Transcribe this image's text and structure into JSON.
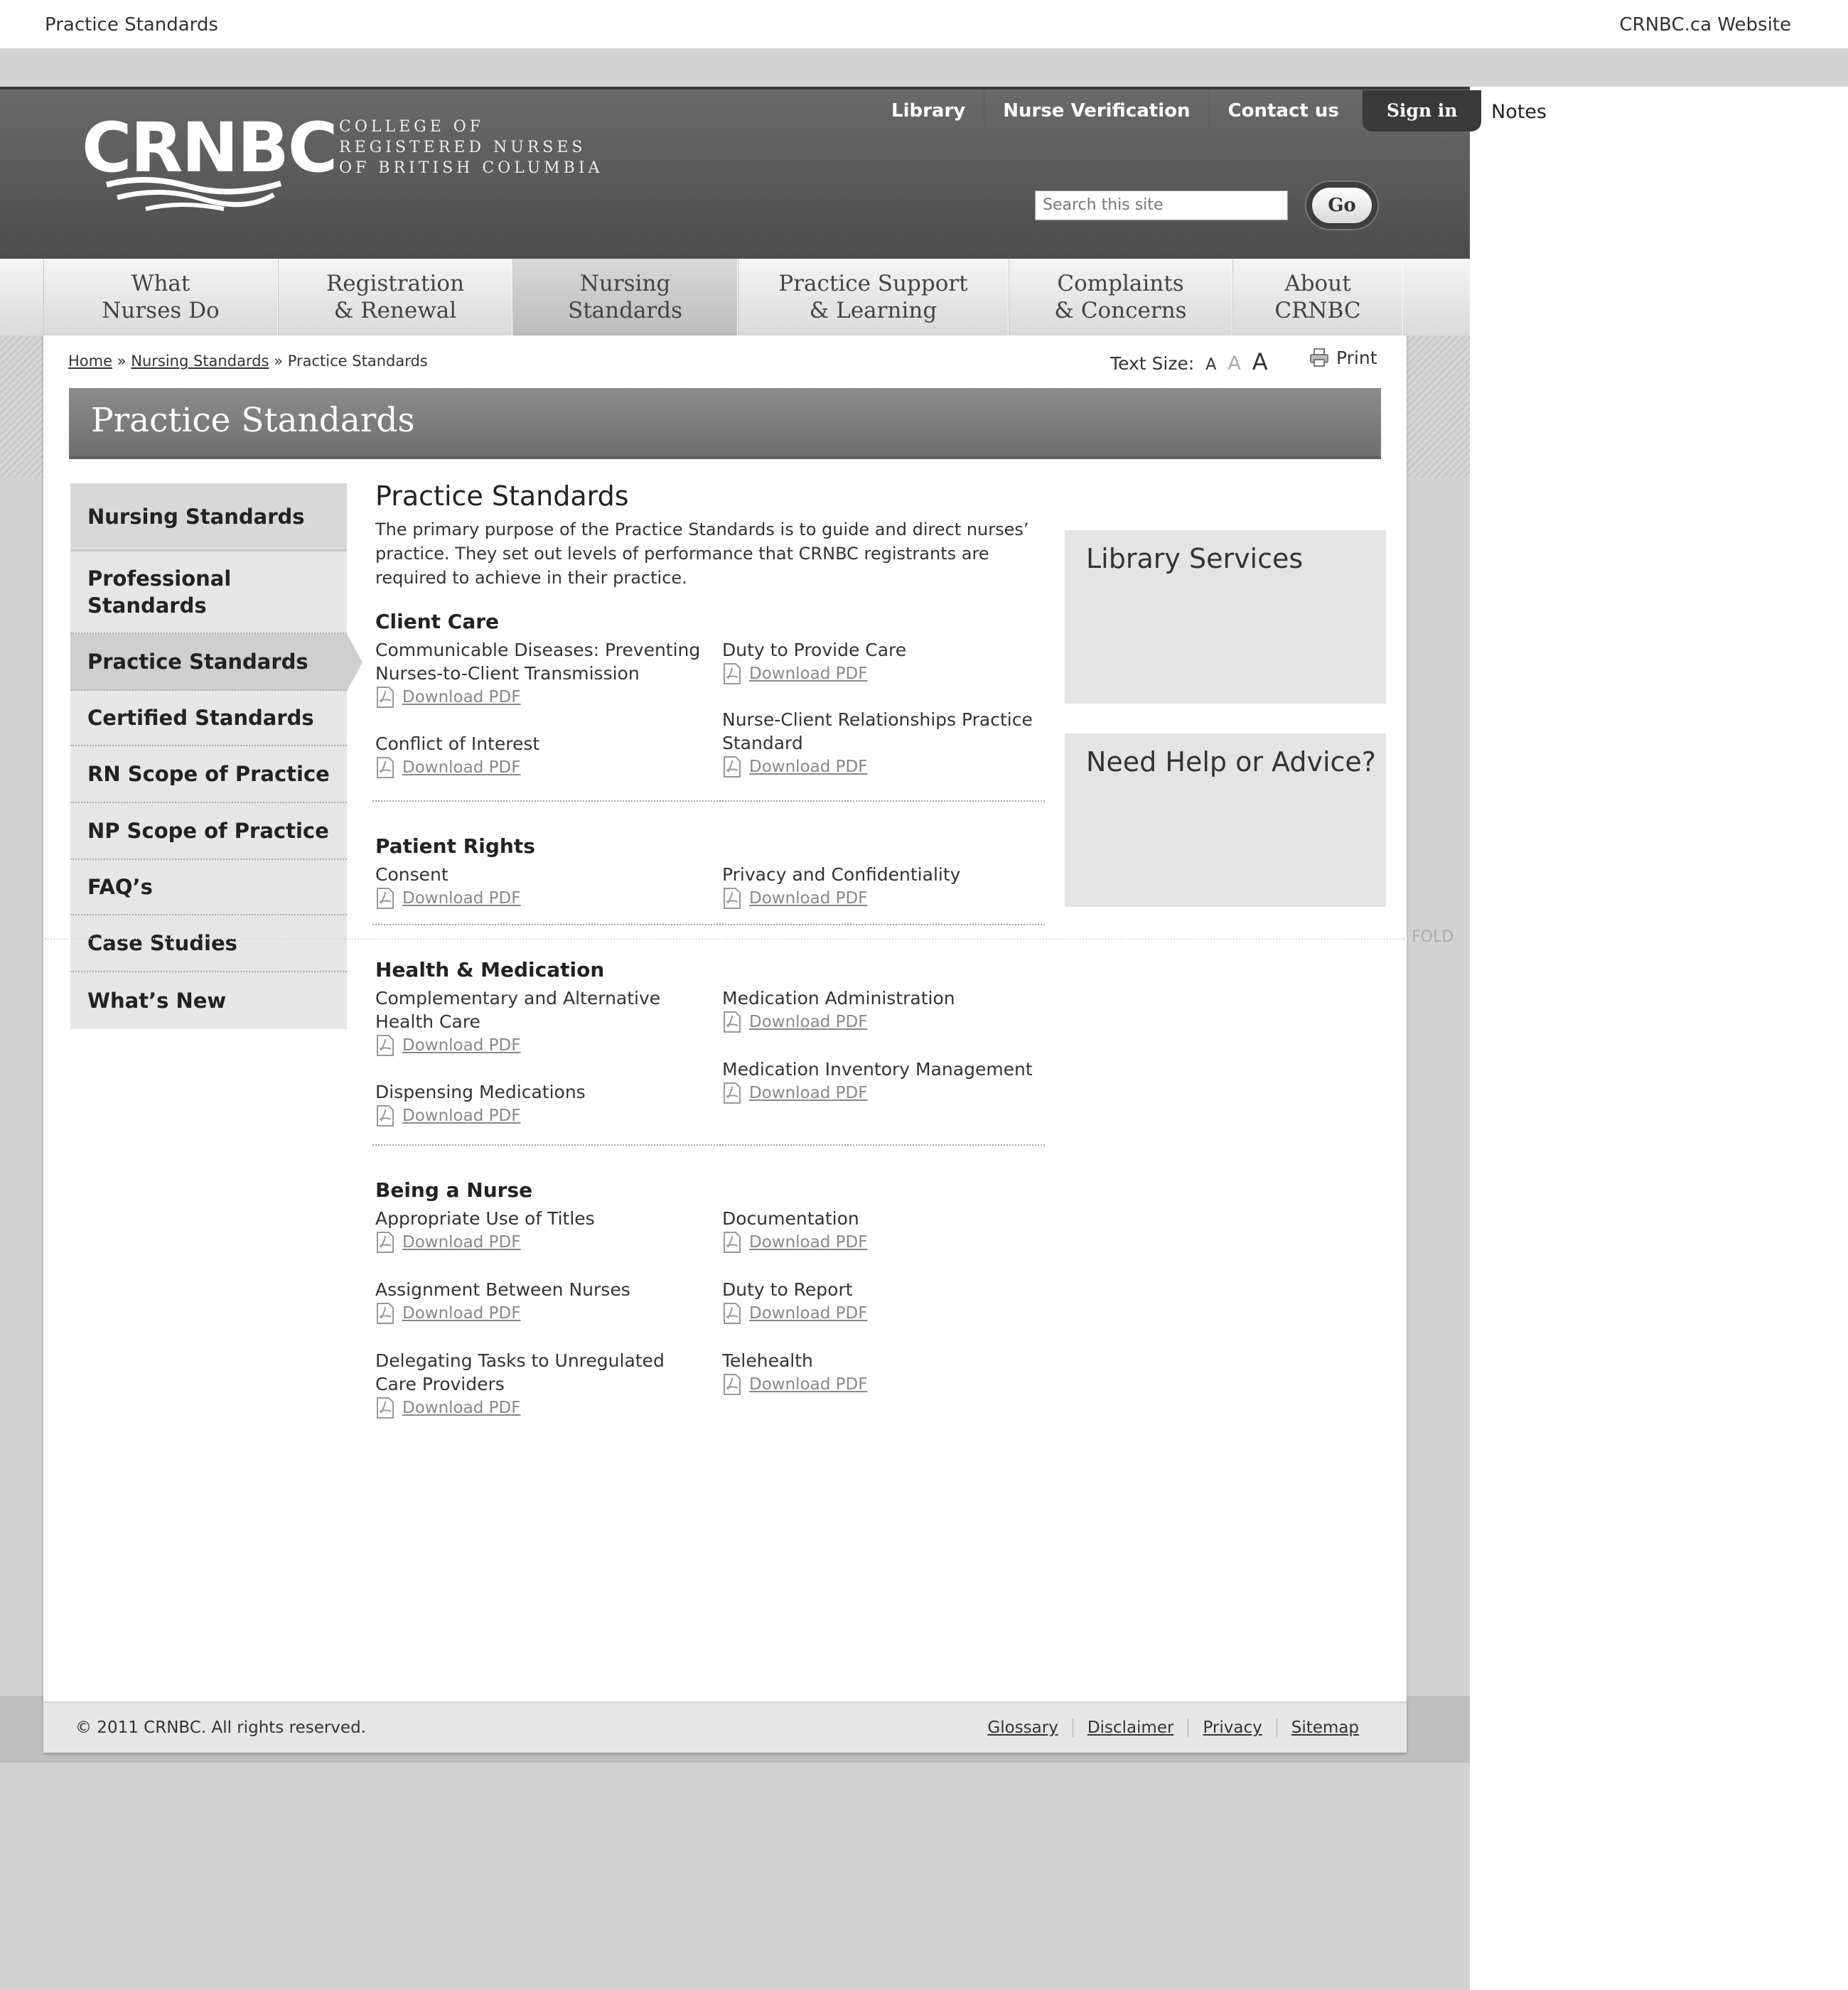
{
  "annotation": {
    "left_title": "Practice Standards",
    "right_title": "CRNBC.ca Website",
    "notes_label": "Notes",
    "fold_label": "FOLD"
  },
  "header": {
    "logo_text": "CRNBC",
    "logo_tagline": [
      "COLLEGE OF",
      "REGISTERED NURSES",
      "OF BRITISH COLUMBIA"
    ],
    "utility_links": [
      "Library",
      "Nurse Verification",
      "Contact us"
    ],
    "sign_in": "Sign in",
    "search_placeholder": "Search this site",
    "go_label": "Go"
  },
  "nav": [
    {
      "line1": "What",
      "line2": "Nurses Do",
      "active": false
    },
    {
      "line1": "Registration",
      "line2": "& Renewal",
      "active": false
    },
    {
      "line1": "Nursing",
      "line2": "Standards",
      "active": true
    },
    {
      "line1": "Practice Support",
      "line2": "& Learning",
      "active": false
    },
    {
      "line1": "Complaints",
      "line2": "& Concerns",
      "active": false
    },
    {
      "line1": "About",
      "line2": "CRNBC",
      "active": false
    }
  ],
  "breadcrumb": {
    "home": "Home",
    "sep": "»",
    "parent": "Nursing Standards",
    "current": "Practice Standards"
  },
  "text_size": {
    "label": "Text Size:",
    "small": "A",
    "medium": "A",
    "large": "A"
  },
  "print_label": "Print",
  "page_title": "Practice Standards",
  "sidebar": [
    "Nursing Standards",
    "Professional Standards",
    "Practice Standards",
    "Certified Standards",
    "RN Scope of Practice",
    "NP Scope of Practice",
    "FAQ’s",
    "Case Studies",
    "What’s New"
  ],
  "main": {
    "heading": "Practice Standards",
    "intro": "The primary purpose of the Practice Standards is to guide and direct nurses’ practice. They set out levels of performance that CRNBC registrants are required to achieve in their practice.",
    "download_label": "Download PDF",
    "sections": [
      {
        "title": "Client Care",
        "left": [
          "Communicable Diseases: Preventing Nurses-to-Client Transmission",
          "Conflict of Interest"
        ],
        "right": [
          "Duty to Provide Care",
          "Nurse-Client Relationships Practice Standard"
        ]
      },
      {
        "title": "Patient Rights",
        "left": [
          "Consent"
        ],
        "right": [
          "Privacy and Confidentiality"
        ]
      },
      {
        "title": "Health & Medication",
        "left": [
          "Complementary and Alternative Health Care",
          "Dispensing Medications"
        ],
        "right": [
          "Medication Administration",
          "Medication Inventory Management"
        ]
      },
      {
        "title": "Being a Nurse",
        "left": [
          "Appropriate Use of Titles",
          "Assignment Between Nurses",
          "Delegating Tasks to Unregulated Care Providers"
        ],
        "right": [
          "Documentation",
          "Duty to Report",
          "Telehealth"
        ]
      }
    ]
  },
  "right_boxes": [
    "Library Services",
    "Need Help or Advice?"
  ],
  "footer": {
    "copyright": "© 2011 CRNBC. All rights reserved.",
    "links": [
      "Glossary",
      "Disclaimer",
      "Privacy",
      "Sitemap"
    ]
  }
}
